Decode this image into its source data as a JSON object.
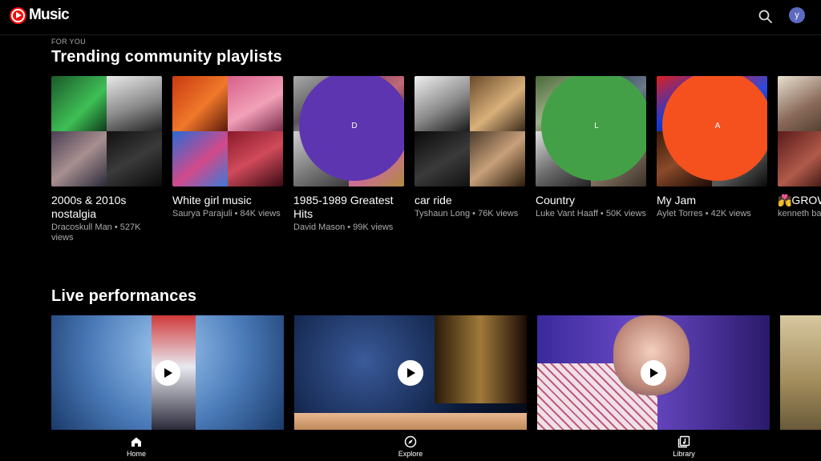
{
  "app": {
    "logo_text": "Music",
    "avatar_initial": "y"
  },
  "icons": {
    "search": "search-icon",
    "home": "home-icon",
    "explore": "compass-icon",
    "library": "library-icon",
    "play": "play-icon"
  },
  "colors": {
    "brand": "#ff0000",
    "background": "#000000",
    "secondary_text": "#aaaaaa",
    "avatar": "#5c6bc0"
  },
  "section1": {
    "eyebrow": "FOR YOU",
    "title": "Trending community playlists",
    "cards": [
      {
        "title": "2000s & 2010s nostalgia",
        "subtitle": "Dracoskull Man • 527K views"
      },
      {
        "title": "White girl music",
        "subtitle": "Saurya Parajuli • 84K views"
      },
      {
        "title": "1985-1989 Greatest Hits",
        "subtitle": "David Mason • 99K views",
        "owner_initial": "D"
      },
      {
        "title": "car ride",
        "subtitle": "Tyshaun Long • 76K views"
      },
      {
        "title": "Country",
        "subtitle": "Luke Vant Haaff • 50K views",
        "owner_initial": "L"
      },
      {
        "title": "My Jam",
        "subtitle": "Aylet Torres • 42K views",
        "owner_initial": "A"
      },
      {
        "title": "💏GROW 🥳",
        "subtitle": "kenneth ba"
      }
    ]
  },
  "section2": {
    "title": "Live performances"
  },
  "nav": {
    "home": "Home",
    "explore": "Explore",
    "library": "Library"
  }
}
